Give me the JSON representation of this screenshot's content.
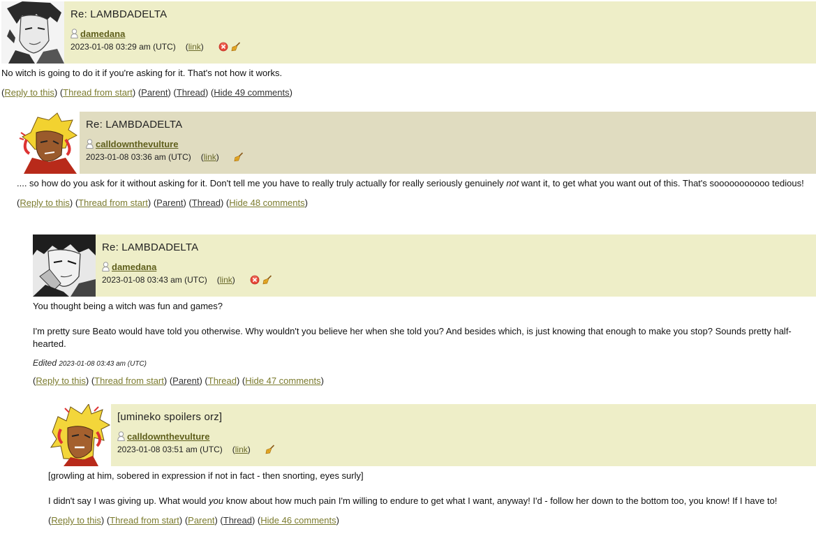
{
  "comments": [
    {
      "subject": "Re: LAMBDADELTA",
      "user": "damedana",
      "timestamp": "2023-01-08 03:29 am (UTC)",
      "link_label": "link",
      "body": [
        "No witch is going to do it if you're asking for it. That's not how it works."
      ],
      "actions": {
        "reply": "Reply to this",
        "thread_start": "Thread from start",
        "parent": "Parent",
        "thread": "Thread",
        "hide": "Hide 49 comments"
      }
    },
    {
      "subject": "Re: LAMBDADELTA",
      "user": "calldownthevulture",
      "timestamp": "2023-01-08 03:36 am (UTC)",
      "link_label": "link",
      "body_pre": ".... so how do you ask for it without asking for it. Don't tell me you have to really truly actually for really seriously genuinely ",
      "body_em": "not",
      "body_post": " want it, to get what you want out of this. That's sooooooooooo tedious!",
      "actions": {
        "reply": "Reply to this",
        "thread_start": "Thread from start",
        "parent": "Parent",
        "thread": "Thread",
        "hide": "Hide 48 comments"
      }
    },
    {
      "subject": "Re: LAMBDADELTA",
      "user": "damedana",
      "timestamp": "2023-01-08 03:43 am (UTC)",
      "link_label": "link",
      "body": [
        "You thought being a witch was fun and games?",
        "I'm pretty sure Beato would have told you otherwise. Why wouldn't you believe her when she told you? And besides which, is just knowing that enough to make you stop? Sounds pretty half-hearted."
      ],
      "edited_label": "Edited",
      "edited_ts": "2023-01-08 03:43 am (UTC)",
      "actions": {
        "reply": "Reply to this",
        "thread_start": "Thread from start",
        "parent": "Parent",
        "thread": "Thread",
        "hide": "Hide 47 comments"
      }
    },
    {
      "subject": "[umineko spoilers orz]",
      "user": "calldownthevulture",
      "timestamp": "2023-01-08 03:51 am (UTC)",
      "link_label": "link",
      "body1": "[growling at him, sobered in expression if not in fact - then snorting, eyes surly]",
      "body2_pre": "I didn't say I was giving up. What would ",
      "body2_em": "you",
      "body2_post": " know about how much pain I'm willing to endure to get what I want, anyway! I'd - follow her down to the bottom too, you know! If I have to!",
      "actions": {
        "reply": "Reply to this",
        "thread_start": "Thread from start",
        "parent": "Parent",
        "thread": "Thread",
        "hide": "Hide 46 comments"
      }
    }
  ],
  "icons": {
    "user": "user-silhouette-icon",
    "delete": "delete-icon",
    "screen": "screen-broom-icon"
  },
  "colors": {
    "header_bg": "#eeeec8",
    "header_bg_alt": "#e0dcc0",
    "link": "#7b7b2e"
  }
}
